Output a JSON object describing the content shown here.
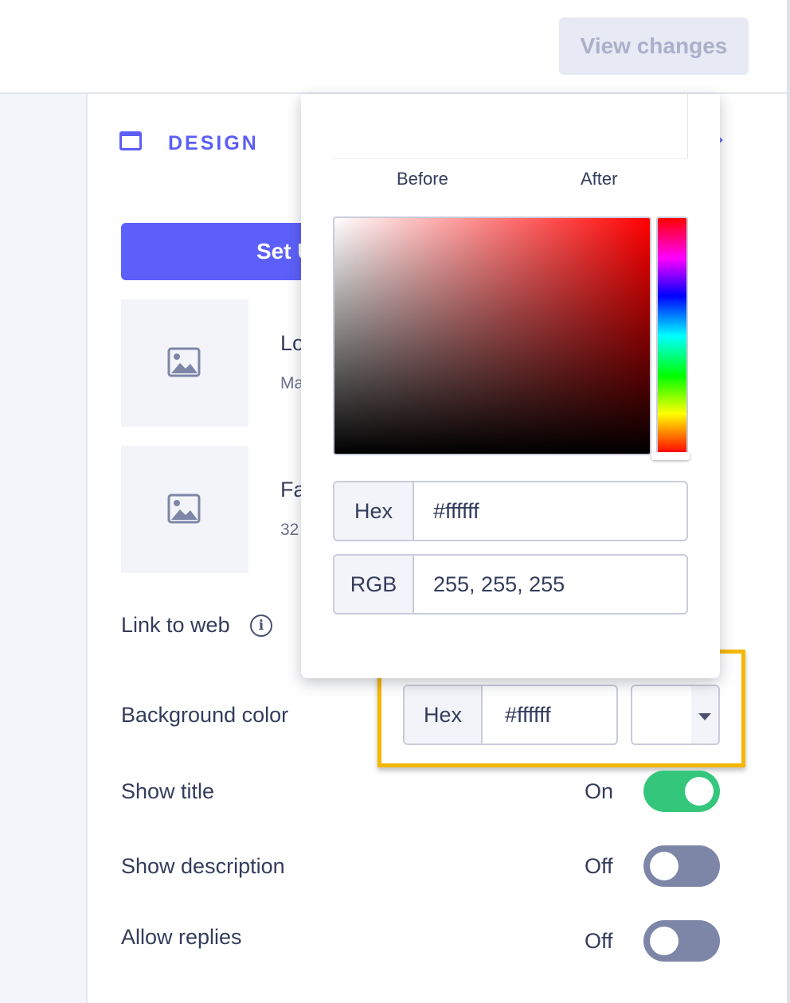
{
  "topbar": {
    "view_changes_label": "View changes"
  },
  "section": {
    "icon": "browser-window-icon",
    "title": "DESIGN"
  },
  "setup_button_label": "Set U",
  "assets": [
    {
      "icon": "image-placeholder-icon",
      "title": "Lo",
      "subtitle": "Ma"
    },
    {
      "icon": "image-placeholder-icon",
      "title": "Fa",
      "subtitle": "32"
    }
  ],
  "link_to_web": {
    "label": "Link to web",
    "info_icon": "info-icon",
    "info_glyph": "i"
  },
  "background_color": {
    "label": "Background color",
    "mode_label": "Hex",
    "value": "#ffffff",
    "swatch_color": "#ffffff"
  },
  "color_picker": {
    "before_label": "Before",
    "after_label": "After",
    "hue_color": "#ff0000",
    "hex_label": "Hex",
    "hex_value": "#ffffff",
    "rgb_label": "RGB",
    "rgb_value": "255, 255, 255"
  },
  "toggles": [
    {
      "label": "Show title",
      "state": "On",
      "on": true
    },
    {
      "label": "Show description",
      "state": "Off",
      "on": false
    },
    {
      "label": "Allow replies",
      "state": "Off",
      "on": false
    }
  ],
  "colors": {
    "accent": "#5b5ef7",
    "toggle_on": "#34c77b",
    "toggle_off": "#7d86a7",
    "highlight": "#f5b700"
  }
}
